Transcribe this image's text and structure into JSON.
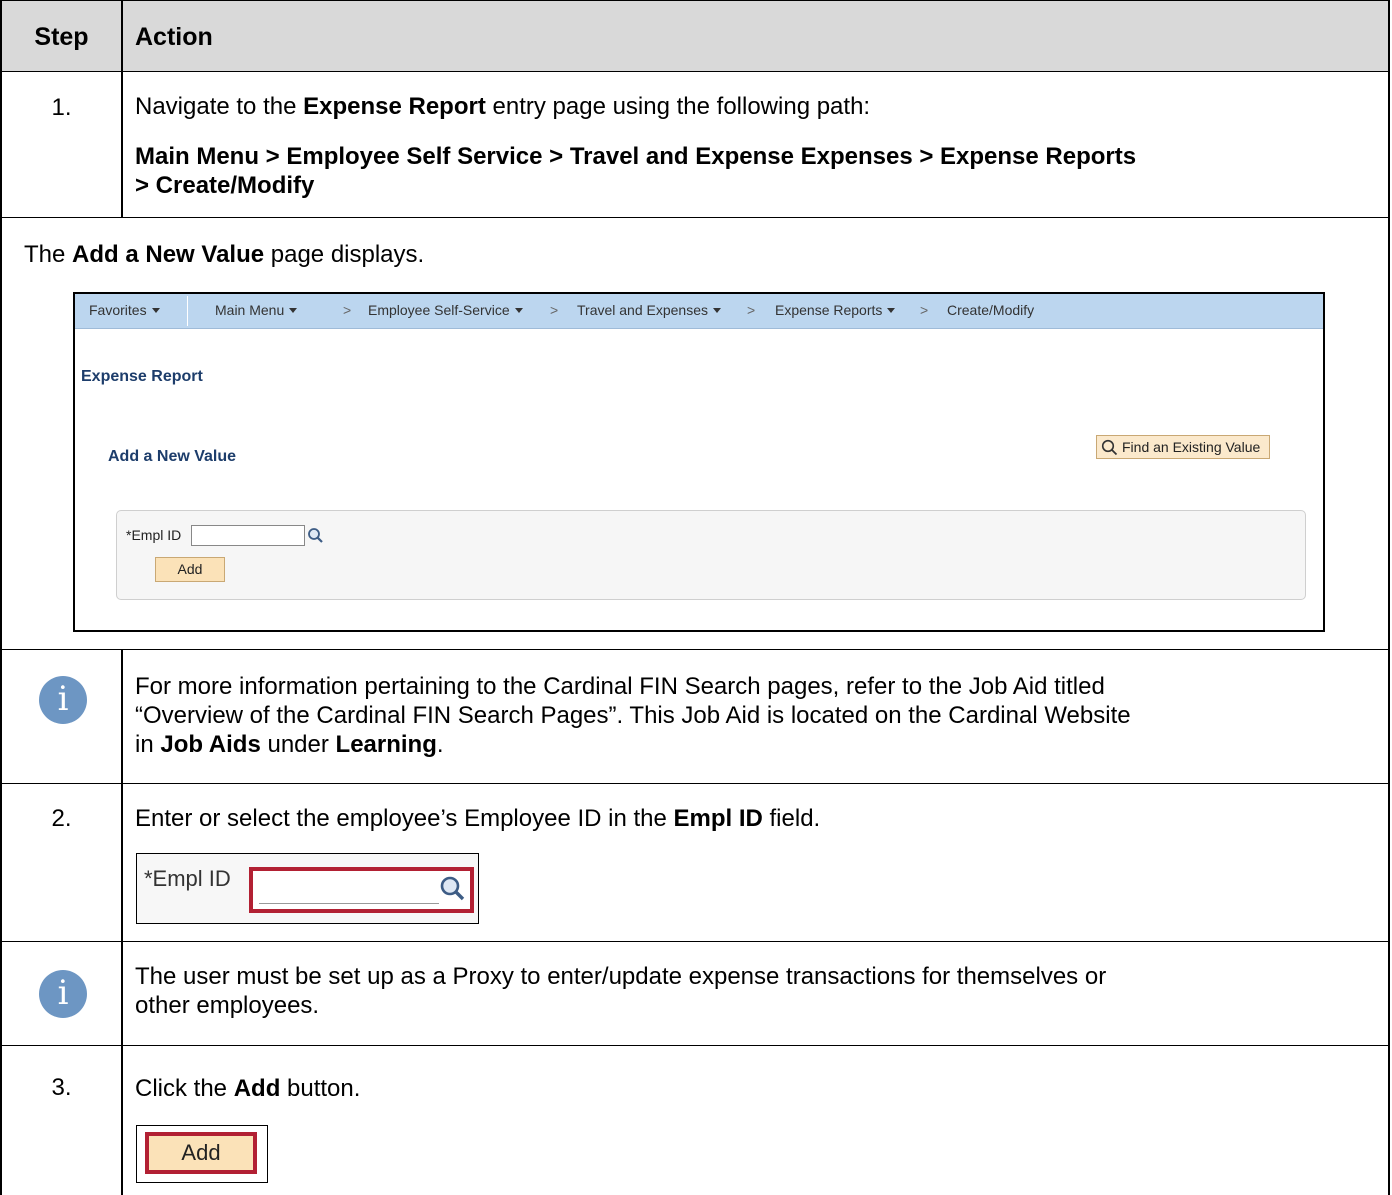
{
  "table": {
    "header": {
      "step": "Step",
      "action": "Action"
    },
    "step1": {
      "number": "1.",
      "line1_a": "Navigate to the ",
      "line1_b": "Expense Report",
      "line1_c": " entry page using the following path:",
      "path_line1": "Main Menu > Employee Self Service > Travel and Expense Expenses > Expense Reports",
      "path_line2": "> Create/Modify"
    },
    "page_displays": {
      "a": "The ",
      "b": "Add a New Value",
      "c": " page displays."
    },
    "screenshot1": {
      "nav": {
        "favorites": "Favorites",
        "main_menu": "Main Menu",
        "employee_self_service": "Employee Self-Service",
        "travel_and_expenses": "Travel and Expenses",
        "expense_reports": "Expense Reports",
        "create_modify": "Create/Modify",
        "chevron": ">"
      },
      "page_title": "Expense Report",
      "section_title": "Add a New Value",
      "find_button": "Find an Existing Value",
      "empl_id_label": "*Empl ID",
      "add_button": "Add"
    },
    "info1": {
      "line1": "For more information pertaining to the Cardinal FIN Search pages, refer to the Job Aid titled",
      "line2": "“Overview of the Cardinal FIN Search Pages”.  This Job Aid is located on the Cardinal Website",
      "line3_a": "in ",
      "line3_b": "Job Aids",
      "line3_c": " under ",
      "line3_d": "Learning",
      "line3_e": "."
    },
    "step2": {
      "number": "2.",
      "a": "Enter or select the employee’s Employee ID in the ",
      "b": "Empl ID",
      "c": " field.",
      "shot_label": "*Empl ID"
    },
    "info2": {
      "line1": "The user must be set up as a Proxy to enter/update expense transactions for themselves or",
      "line2": "other employees."
    },
    "step3": {
      "number": "3.",
      "a": "Click the ",
      "b": "Add",
      "c": " button.",
      "shot_button": "Add"
    }
  },
  "icons": [
    "info-icon",
    "magnifier-icon",
    "caret-down-icon",
    "chevron-right-icon"
  ],
  "colors": {
    "header_bg": "#d9d9d9",
    "nav_bg": "#bcd6ef",
    "title_blue": "#1d3d6b",
    "info_blue": "#6d96c3",
    "highlight_red": "#b22033",
    "button_bg": "#fbe2b8"
  }
}
